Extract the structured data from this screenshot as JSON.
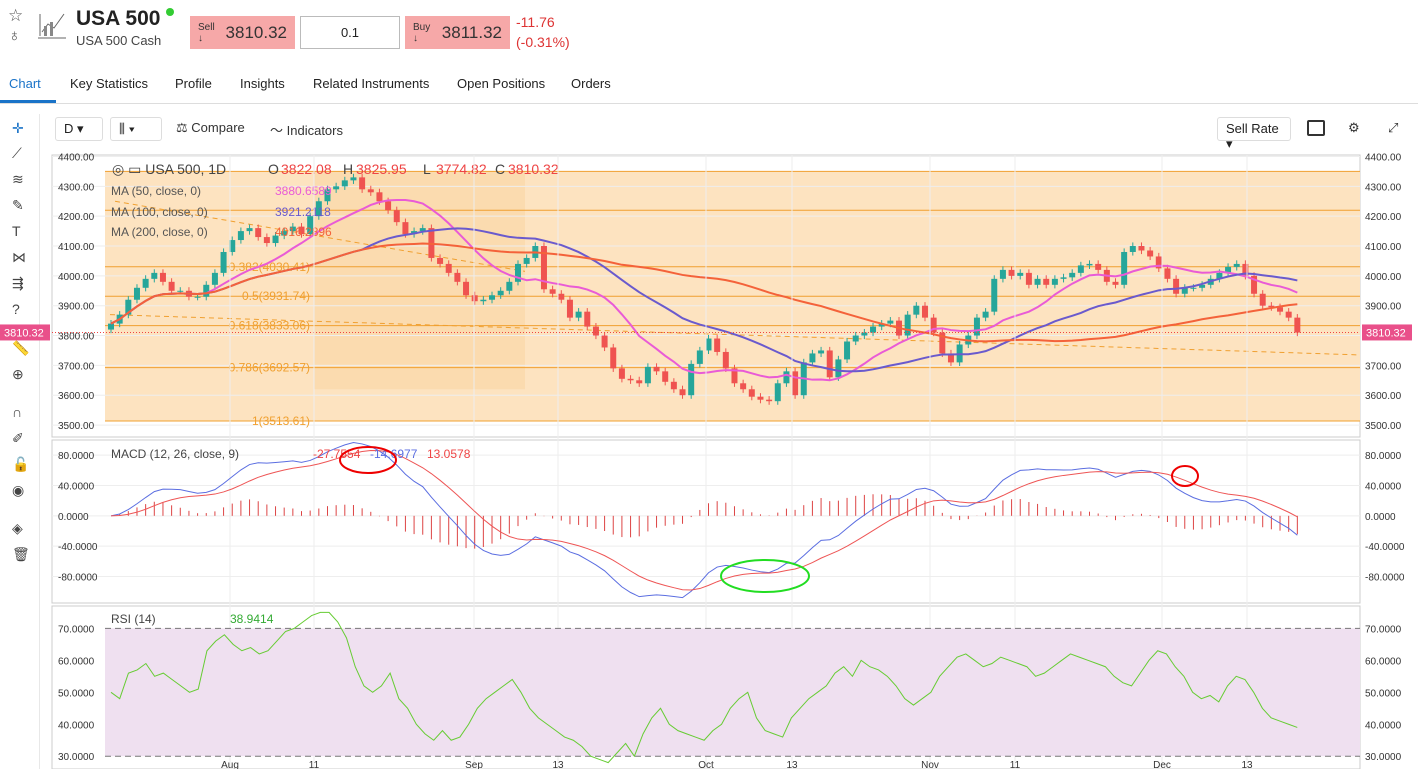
{
  "header": {
    "title": "USA 500",
    "subtitle": "USA 500 Cash",
    "sell_label": "Sell ↓",
    "sell_price": "3810.32",
    "qty": "0.1",
    "buy_label": "Buy ↓",
    "buy_price": "3811.32",
    "change": "-11.76",
    "change_pct": "(-0.31%)"
  },
  "tabs": [
    "Chart",
    "Key Statistics",
    "Profile",
    "Insights",
    "Related Instruments",
    "Open Positions",
    "Orders"
  ],
  "toolbar": {
    "interval": "D",
    "compare": "Compare",
    "indicators": "Indicators",
    "rate": "Sell Rate"
  },
  "legend": {
    "symbol": "USA 500, 1D",
    "o_label": "O",
    "o": "3822.08",
    "h_label": "H",
    "h": "3825.95",
    "l_label": "L",
    "l": "3774.82",
    "c_label": "C",
    "c": "3810.32",
    "ma50": "MA (50, close, 0)",
    "ma50v": "3880.6589",
    "ma100": "MA (100, close, 0)",
    "ma100v": "3921.2118",
    "ma200": "MA (200, close, 0)",
    "ma200v": "4016.2896"
  },
  "colors": {
    "up": "#26a69a",
    "down": "#ef5350",
    "ma50": "#e95bd6",
    "ma100": "#6a5acd",
    "ma200": "#f4623a",
    "fib": "#f0a030",
    "fibbg": "#fde3c0"
  },
  "chart_data": [
    {
      "type": "candlestick",
      "title": "USA 500, 1D",
      "x_ticks": [
        "Aug",
        "11",
        "Sep",
        "13",
        "Oct",
        "13",
        "Nov",
        "11",
        "Dec",
        "13"
      ],
      "y_ticks": [
        "4400.00",
        "4300.00",
        "4200.00",
        "4100.00",
        "4000.00",
        "3900.00",
        "3800.00",
        "3700.00",
        "3600.00",
        "3500.00"
      ],
      "ylim": [
        3460,
        4405
      ],
      "last_price": "3810.32",
      "closes": [
        3840,
        3870,
        3920,
        3960,
        3990,
        4010,
        3980,
        3950,
        3950,
        3930,
        3930,
        3970,
        4010,
        4080,
        4120,
        4150,
        4160,
        4130,
        4110,
        4135,
        4150,
        4165,
        4140,
        4200,
        4250,
        4290,
        4300,
        4320,
        4330,
        4290,
        4280,
        4250,
        4220,
        4180,
        4140,
        4150,
        4160,
        4060,
        4040,
        4010,
        3980,
        3935,
        3915,
        3920,
        3935,
        3950,
        3980,
        4040,
        4060,
        4100,
        3955,
        3940,
        3920,
        3860,
        3880,
        3830,
        3800,
        3760,
        3690,
        3655,
        3650,
        3640,
        3695,
        3680,
        3645,
        3620,
        3600,
        3705,
        3750,
        3790,
        3745,
        3690,
        3640,
        3620,
        3595,
        3585,
        3580,
        3640,
        3680,
        3600,
        3710,
        3740,
        3750,
        3660,
        3720,
        3780,
        3800,
        3810,
        3830,
        3840,
        3850,
        3800,
        3870,
        3900,
        3860,
        3810,
        3740,
        3710,
        3770,
        3800,
        3860,
        3880,
        3990,
        4020,
        4000,
        4010,
        3970,
        3990,
        3970,
        3990,
        3995,
        4010,
        4035,
        4040,
        4020,
        3980,
        3970,
        4080,
        4100,
        4085,
        4065,
        4025,
        3990,
        3940,
        3960,
        3960,
        3970,
        3990,
        4010,
        4030,
        4040,
        4000,
        3940,
        3900,
        3895,
        3880,
        3860,
        3810
      ],
      "fib_levels": [
        {
          "label": "0.382(4030.41)",
          "value": 4030.41
        },
        {
          "label": "0.5(3931.74)",
          "value": 3931.74
        },
        {
          "label": "0.618(3833.06)",
          "value": 3833.06
        },
        {
          "label": "0.786(3692.57)",
          "value": 3692.57
        },
        {
          "label": "1(3513.61)",
          "value": 3513.61
        }
      ]
    },
    {
      "type": "line",
      "title": "MACD (12, 26, close, 9)",
      "values": [
        "-27.7554",
        "-14.6977",
        "13.0578"
      ],
      "y_ticks": [
        "80.0000",
        "40.0000",
        "0.0000",
        "-40.0000",
        "-80.0000"
      ],
      "ylim": [
        -115,
        100
      ]
    },
    {
      "type": "line",
      "title": "RSI (14)",
      "value": "38.9414",
      "y_ticks": [
        "70.0000",
        "60.0000",
        "50.0000",
        "40.0000",
        "30.0000"
      ],
      "ylim": [
        26,
        77
      ],
      "values": [
        50,
        48,
        56,
        57,
        59,
        55,
        56,
        54,
        52,
        50,
        51,
        63,
        66,
        68,
        65,
        63,
        64,
        62,
        63,
        66,
        69,
        70,
        72,
        74,
        75,
        75,
        72,
        67,
        58,
        52,
        50,
        52,
        56,
        48,
        45,
        40,
        37,
        35,
        38,
        35,
        36,
        40,
        45,
        48,
        50,
        52,
        54,
        50,
        45,
        42,
        40,
        38,
        36,
        35,
        33,
        30,
        29,
        28,
        31,
        34,
        30,
        37,
        42,
        45,
        40,
        38,
        37,
        36,
        35,
        38,
        40,
        45,
        48,
        50,
        42,
        38,
        37,
        36,
        42,
        45,
        48,
        50,
        52,
        56,
        58,
        55,
        60,
        58,
        57,
        55,
        52,
        48,
        46,
        48,
        50,
        55,
        58,
        61,
        62,
        60,
        58,
        59,
        61,
        60,
        59,
        58,
        55,
        56,
        58,
        60,
        62,
        61,
        60,
        59,
        58,
        55,
        53,
        52,
        56,
        60,
        63,
        62,
        58,
        55,
        50,
        48,
        49,
        47,
        52,
        55,
        54,
        50,
        45,
        42,
        41,
        40,
        39
      ]
    }
  ]
}
